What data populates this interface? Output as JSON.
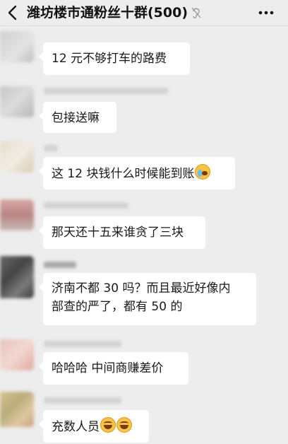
{
  "header": {
    "title": "潍坊楼市通粉丝十群(500)",
    "back_icon": "chevron-left-icon",
    "mute_icon": "mute-ear-icon",
    "more_icon": "more-dots-icon"
  },
  "messages": [
    {
      "text": "12 元不够打车的路费"
    },
    {
      "text": "包接送嘛"
    },
    {
      "text": "这 12 块钱什么时候能到账",
      "emoji": "crying-face-icon"
    },
    {
      "text": "那天还十五来谁贪了三块"
    },
    {
      "line1": "济南不都 30 吗？而且最近好像内",
      "line2": "部查的严了，都有 50 的"
    },
    {
      "text": "哈哈哈  中间商赚差价"
    },
    {
      "text": "充数人员",
      "emoji": "grinning-face-icon"
    }
  ],
  "colors": {
    "background": "#ededed",
    "bubble": "#ffffff",
    "text": "#191919"
  }
}
